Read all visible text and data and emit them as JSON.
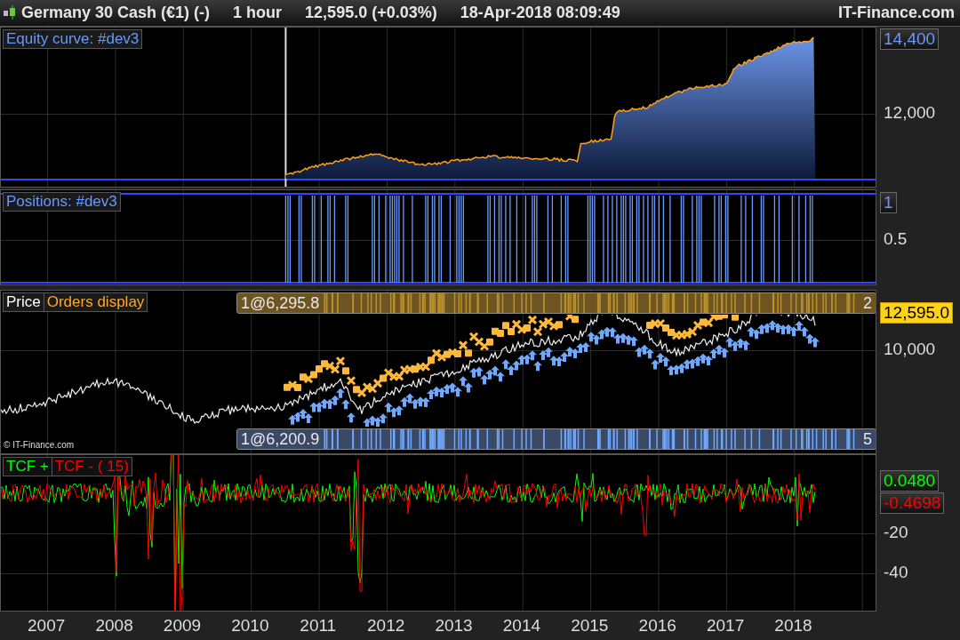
{
  "header": {
    "title": "Germany 30 Cash (€1) (-)",
    "timeframe": "1 hour",
    "quote": "12,595.0 (+0.03%)",
    "datetime": "18-Apr-2018 08:09:49",
    "brand": "IT-Finance.com"
  },
  "equity_panel": {
    "label": "Equity curve: #dev3",
    "value_badge": "14,400",
    "ticks": [
      "12,000"
    ]
  },
  "positions_panel": {
    "label": "Positions: #dev3",
    "value_badge": "1",
    "ticks": [
      "0.5"
    ]
  },
  "price_panel": {
    "labels": [
      {
        "text": "Price",
        "color": "#ffffff"
      },
      {
        "text": "Orders display",
        "color": "#ffa726"
      }
    ],
    "sell_strip": {
      "first": "1@6,295.8",
      "last": "2"
    },
    "buy_strip": {
      "first": "1@6,200.9",
      "last": "5"
    },
    "price_badge": "12,595.0",
    "ticks": [
      "10,000"
    ],
    "copyright": "© IT-Finance.com"
  },
  "indicator_panel": {
    "labels": [
      {
        "text": "TCF +",
        "color": "#00ff00"
      },
      {
        "text": "TCF - ( 15)",
        "color": "#ff0000"
      }
    ],
    "value_badges": [
      {
        "text": "0.0480",
        "color": "#00ff00"
      },
      {
        "text": "-0.4698",
        "color": "#ff0000"
      }
    ],
    "ticks": [
      "-20",
      "-40"
    ]
  },
  "x_axis": [
    "2007",
    "2008",
    "2009",
    "2010",
    "2011",
    "2012",
    "2013",
    "2014",
    "2015",
    "2016",
    "2017",
    "2018"
  ]
}
